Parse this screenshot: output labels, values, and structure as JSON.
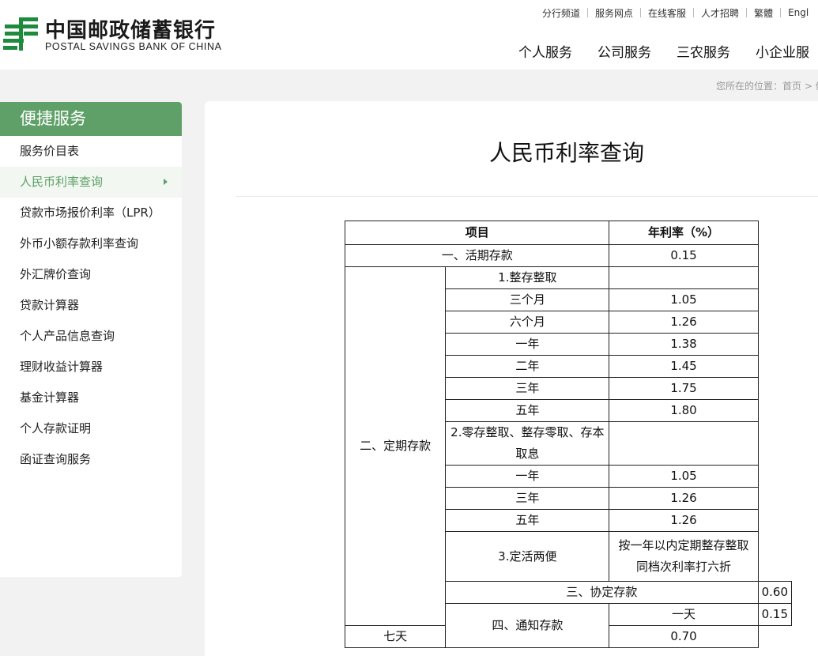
{
  "header": {
    "logo_cn": "中国邮政储蓄银行",
    "logo_en": "POSTAL SAVINGS BANK OF CHINA",
    "brand_color": "#1d8a3c",
    "top_links": [
      "分行频道",
      "服务网点",
      "在线客服",
      "人才招聘",
      "繁體",
      "Engl"
    ],
    "main_nav": [
      "个人服务",
      "公司服务",
      "三农服务",
      "小企业服"
    ]
  },
  "breadcrumb": "您所在的位置：首页 > 便",
  "sidebar": {
    "title": "便捷服务",
    "accent_color": "#5fa068",
    "items": [
      {
        "label": "服务价目表",
        "active": false
      },
      {
        "label": "人民币利率查询",
        "active": true
      },
      {
        "label": "贷款市场报价利率（LPR）",
        "active": false
      },
      {
        "label": "外币小额存款利率查询",
        "active": false
      },
      {
        "label": "外汇牌价查询",
        "active": false
      },
      {
        "label": "贷款计算器",
        "active": false
      },
      {
        "label": "个人产品信息查询",
        "active": false
      },
      {
        "label": "理财收益计算器",
        "active": false
      },
      {
        "label": "基金计算器",
        "active": false
      },
      {
        "label": "个人存款证明",
        "active": false
      },
      {
        "label": "函证查询服务",
        "active": false
      }
    ]
  },
  "main": {
    "title": "人民币利率查询",
    "table": {
      "headers": [
        "项目",
        "年利率（%）"
      ],
      "demand": {
        "label": "一、活期存款",
        "rate": "0.15"
      },
      "fixed": {
        "label": "二、定期存款",
        "lump_sum": {
          "label": "1.整存整取",
          "rows": [
            {
              "term": "三个月",
              "rate": "1.05"
            },
            {
              "term": "六个月",
              "rate": "1.26"
            },
            {
              "term": "一年",
              "rate": "1.38"
            },
            {
              "term": "二年",
              "rate": "1.45"
            },
            {
              "term": "三年",
              "rate": "1.75"
            },
            {
              "term": "五年",
              "rate": "1.80"
            }
          ]
        },
        "installment": {
          "label_line1": "2.零存整取、整存零取、存本",
          "label_line2": "取息",
          "rows": [
            {
              "term": "一年",
              "rate": "1.05"
            },
            {
              "term": "三年",
              "rate": "1.26"
            },
            {
              "term": "五年",
              "rate": "1.26"
            }
          ]
        },
        "flexible": {
          "label": "3.定活两便",
          "rate_line1": "按一年以内定期整存整取",
          "rate_line2": "同档次利率打六折"
        }
      },
      "agreement": {
        "label": "三、协定存款",
        "rate": "0.60"
      },
      "notice": {
        "label": "四、通知存款",
        "rows": [
          {
            "term": "一天",
            "rate": "0.15"
          },
          {
            "term": "七天",
            "rate": "0.70"
          }
        ]
      }
    }
  }
}
